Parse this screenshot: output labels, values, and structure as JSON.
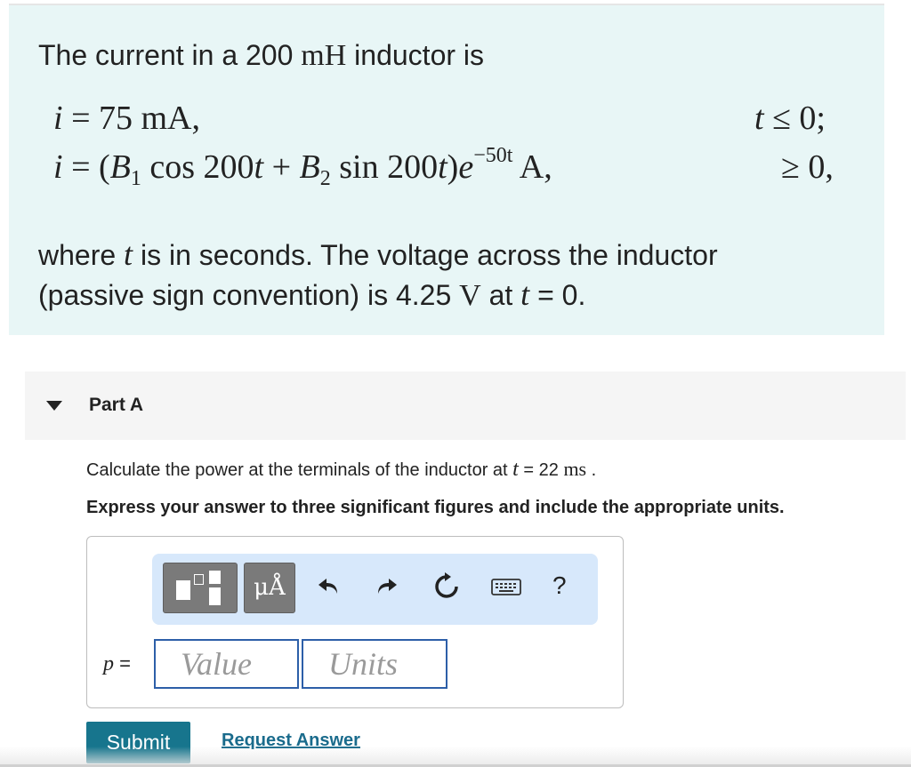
{
  "problem": {
    "intro_text": "The current in a 200 ",
    "intro_unit": "mH",
    "intro_end": " inductor is",
    "eq1": {
      "lhs": "i",
      "rhs": " = 75 mA,",
      "condition_var": "t",
      "condition": " ≤ 0;"
    },
    "eq2": {
      "lhs": "i",
      "eq_open": " = (",
      "b1": "B",
      "b1_sub": "1",
      "cos_part": " cos 200",
      "t1": "t",
      "plus": " + ",
      "b2": "B",
      "b2_sub": "2",
      "sin_part": " sin 200",
      "t2": "t",
      "close": ")",
      "e": "e",
      "exp": "−50t",
      "unit": " A,",
      "condition": "≥ 0,"
    },
    "desc_1": "where ",
    "desc_t": "t",
    "desc_2": " is in seconds. The voltage across the inductor",
    "desc_3": "(passive sign convention) is 4.25 ",
    "desc_unit": "V",
    "desc_4": " at ",
    "desc_t2": "t",
    "desc_5": " = 0."
  },
  "part": {
    "title": "Part A"
  },
  "question": {
    "text_1": "Calculate the power at the terminals of the inductor at ",
    "t": "t",
    "text_2": " = 22 ",
    "unit": "ms",
    "text_3": " .",
    "instruction": "Express your answer to three significant figures and include the appropriate units."
  },
  "toolbar": {
    "templates_icon": "templates-icon",
    "units_label": "μÅ",
    "undo_icon": "undo-icon",
    "redo_icon": "redo-icon",
    "reset_icon": "reset-icon",
    "keyboard_icon": "keyboard-icon",
    "help_label": "?"
  },
  "answer": {
    "variable": "p",
    "equals": " =",
    "value_placeholder": "Value",
    "units_placeholder": "Units"
  },
  "actions": {
    "submit_label": "Submit",
    "request_label": "Request Answer"
  },
  "colors": {
    "problem_bg": "#e8f6f6",
    "toolbar_bg": "#d7e8fb",
    "submit_bg": "#17758d",
    "input_border": "#2d5fa8",
    "link": "#1a6b8c"
  }
}
